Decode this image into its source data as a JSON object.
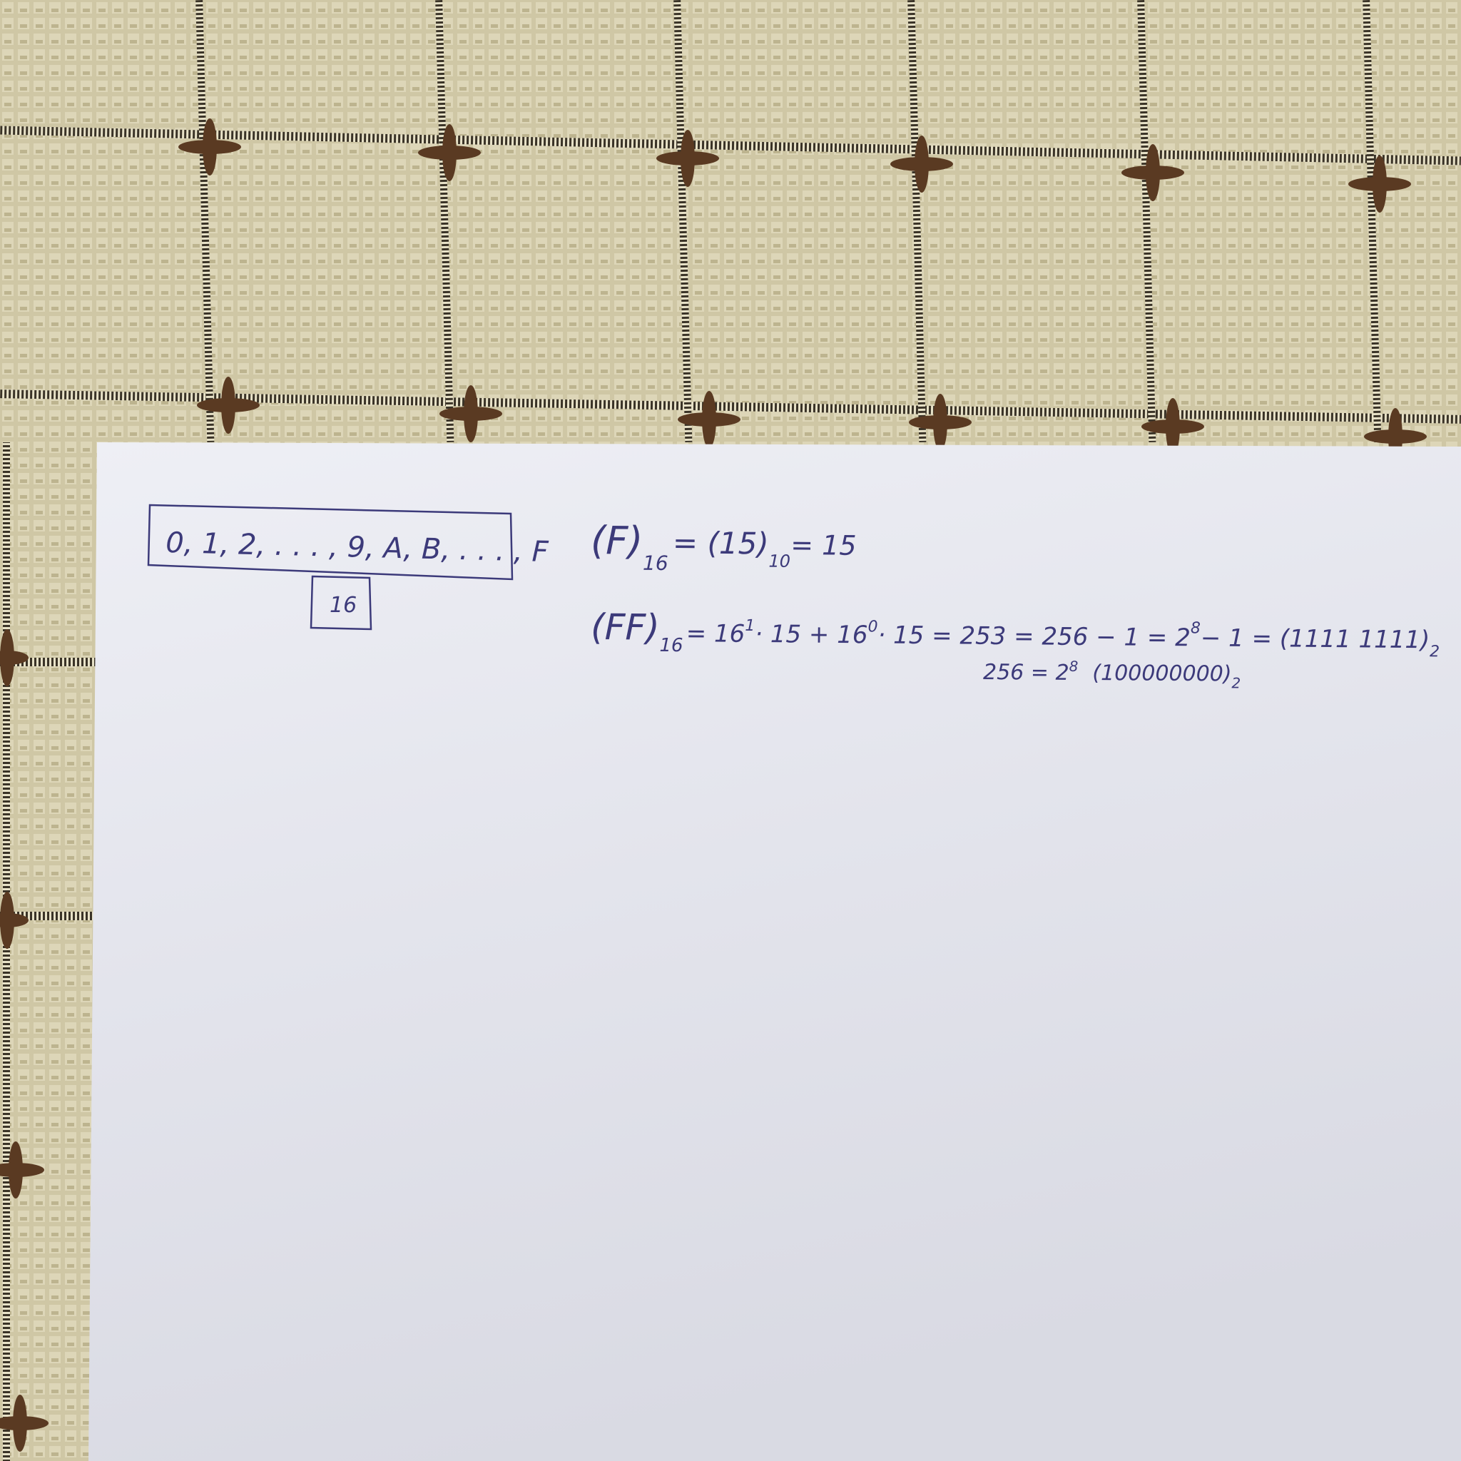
{
  "notes": {
    "digit_set": "0, 1, 2, . . . , 9, A, B, . . . , F",
    "base_box": "16",
    "line1": {
      "lhs": "(F)",
      "lhs_sub": "16",
      "eq1": "= (15)",
      "eq1_sub": "10",
      "eq2": "= 15"
    },
    "line2": {
      "lhs": "(FF)",
      "lhs_sub": "16",
      "expr_a": "= 16",
      "expr_a_sup": "1",
      "expr_b": "· 15 + 16",
      "expr_b_sup": "0",
      "expr_c": "· 15 = 253 = 256 − 1 = 2",
      "expr_c_sup": "8",
      "expr_d": "− 1 = (1111 1111)",
      "expr_d_sub": "2"
    },
    "line3": {
      "text_a": "256 = 2",
      "text_a_sup": "8",
      "text_b": "(100000000)",
      "text_b_sub": "2"
    }
  },
  "colors": {
    "fabric": "#cfc7a5",
    "stripe": "#3a3327",
    "knot": "#5a3a22",
    "paper": "#e6e8ef",
    "ink": "#3c3a7a"
  }
}
